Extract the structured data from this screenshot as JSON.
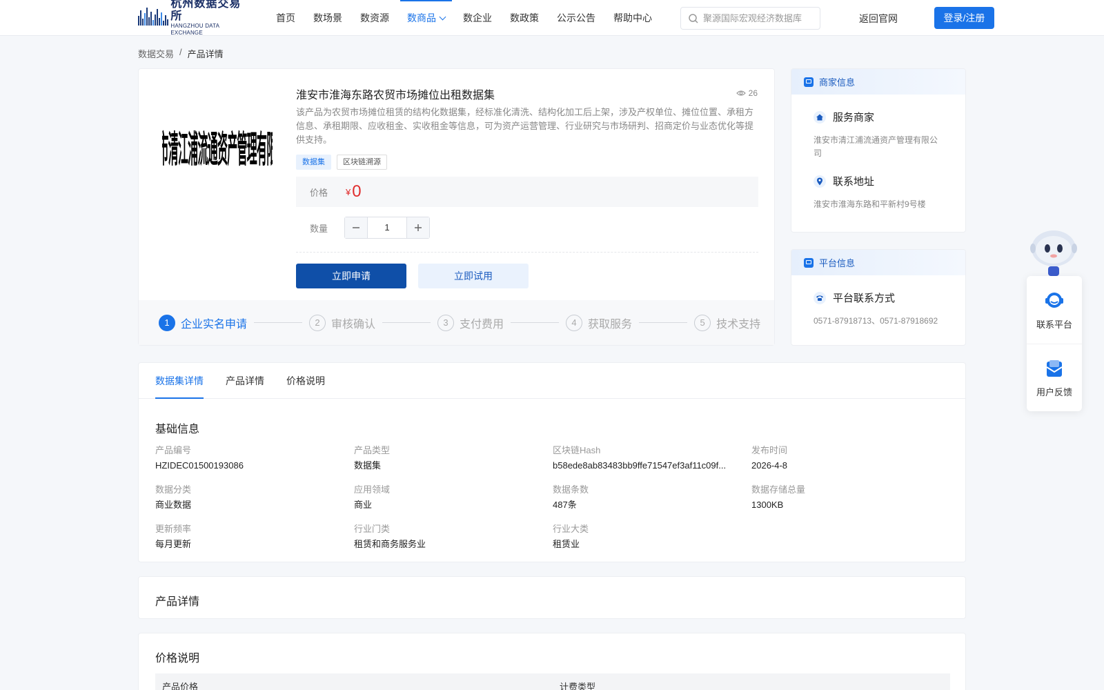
{
  "header": {
    "logo_cn": "杭州数据交易所",
    "logo_en": "HANGZHOU DATA EXCHANGE",
    "nav": [
      "首页",
      "数场景",
      "数资源",
      "数商品",
      "数企业",
      "数政策",
      "公示公告",
      "帮助中心"
    ],
    "active_nav": "数商品",
    "search_placeholder": "聚源国际宏观经济数据库",
    "back_link": "返回官网",
    "login": "登录/注册"
  },
  "breadcrumb": {
    "root": "数据交易",
    "sep": "/",
    "current": "产品详情"
  },
  "product": {
    "seal_text": "淮安市清江浦流通资产管理有限公司",
    "title": "淮安市淮海东路农贸市场摊位出租数据集",
    "views": "26",
    "description": "该产品为农贸市场摊位租赁的结构化数据集，经标准化清洗、结构化加工后上架，涉及产权单位、摊位位置、承租方信息、承租期限、应收租金、实收租金等信息，可为资产运营管理、行业研究与市场研判、招商定价与业态优化等提供支持。",
    "tags": [
      "数据集",
      "区块链溯源"
    ],
    "price_label": "价格",
    "currency": "¥",
    "price": "0",
    "qty_label": "数量",
    "qty": "1",
    "apply_btn": "立即申请",
    "trial_btn": "立即试用"
  },
  "steps": [
    {
      "num": "1",
      "label": "企业实名申请"
    },
    {
      "num": "2",
      "label": "审核确认"
    },
    {
      "num": "3",
      "label": "支付费用"
    },
    {
      "num": "4",
      "label": "获取服务"
    },
    {
      "num": "5",
      "label": "技术支持"
    }
  ],
  "merchant": {
    "head": "商家信息",
    "service_title": "服务商家",
    "service_value": "淮安市清江浦流通资产管理有限公司",
    "address_title": "联系地址",
    "address_value": "淮安市淮海东路和平新村9号楼"
  },
  "platform": {
    "head": "平台信息",
    "contact_title": "平台联系方式",
    "contact_value": "0571-87918713、0571-87918692"
  },
  "tabs": [
    "数据集详情",
    "产品详情",
    "价格说明"
  ],
  "basic": {
    "title": "基础信息",
    "fields": [
      {
        "label": "产品编号",
        "value": "HZIDEC01500193086"
      },
      {
        "label": "产品类型",
        "value": "数据集"
      },
      {
        "label": "区块链Hash",
        "value": "b58ede8ab83483bb9ffe71547ef3af11c09f..."
      },
      {
        "label": "发布时间",
        "value": "2026-4-8"
      },
      {
        "label": "数据分类",
        "value": "商业数据"
      },
      {
        "label": "应用领域",
        "value": "商业"
      },
      {
        "label": "数据条数",
        "value": "487条"
      },
      {
        "label": "数据存储总量",
        "value": "1300KB"
      },
      {
        "label": "更新频率",
        "value": "每月更新"
      },
      {
        "label": "行业门类",
        "value": "租赁和商务服务业"
      },
      {
        "label": "行业大类",
        "value": "租赁业"
      }
    ]
  },
  "detail_section": {
    "title": "产品详情"
  },
  "price_section": {
    "title": "价格说明",
    "col1": "产品价格",
    "col2": "计费类型"
  },
  "float": {
    "contact": "联系平台",
    "feedback": "用户反馈"
  },
  "colors": {
    "primary": "#1a73e8",
    "dark_primary": "#0f4fa8",
    "price": "#e02d2d"
  }
}
